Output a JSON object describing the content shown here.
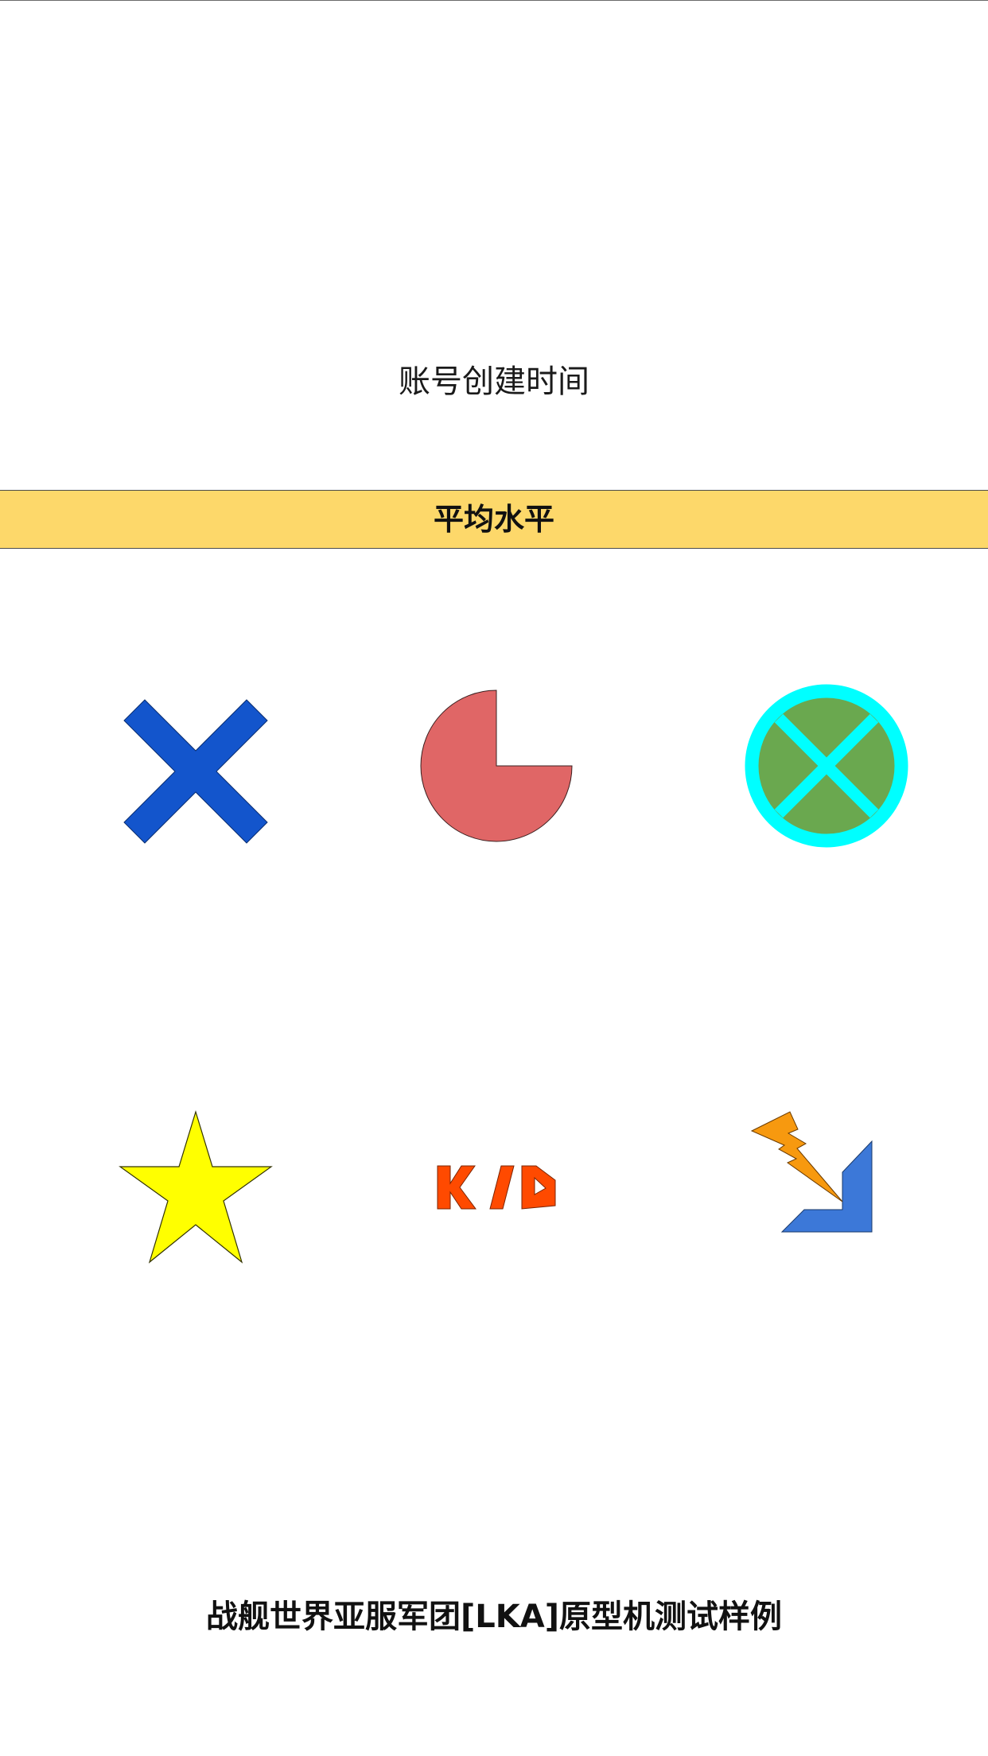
{
  "header": {
    "subtitle": "账号创建时间"
  },
  "banner": {
    "label": "平均水平",
    "background": "#fdd86a"
  },
  "icons": {
    "row1": [
      {
        "name": "blue-cross-icon",
        "color": "#1355cc"
      },
      {
        "name": "red-pie-icon",
        "color": "#e06666"
      },
      {
        "name": "green-circle-cross-icon",
        "fill": "#6aa84f",
        "ring": "#00ffff"
      }
    ],
    "row2": [
      {
        "name": "yellow-star-icon",
        "color": "#ffff00"
      },
      {
        "name": "kd-ratio-icon",
        "text": "K/D",
        "color": "#ff4a00"
      },
      {
        "name": "lightning-corner-icon",
        "bolt": "#f7990f",
        "corner": "#3c78d8"
      }
    ]
  },
  "footer": {
    "title": "战舰世界亚服军团[LKA]原型机测试样例"
  }
}
